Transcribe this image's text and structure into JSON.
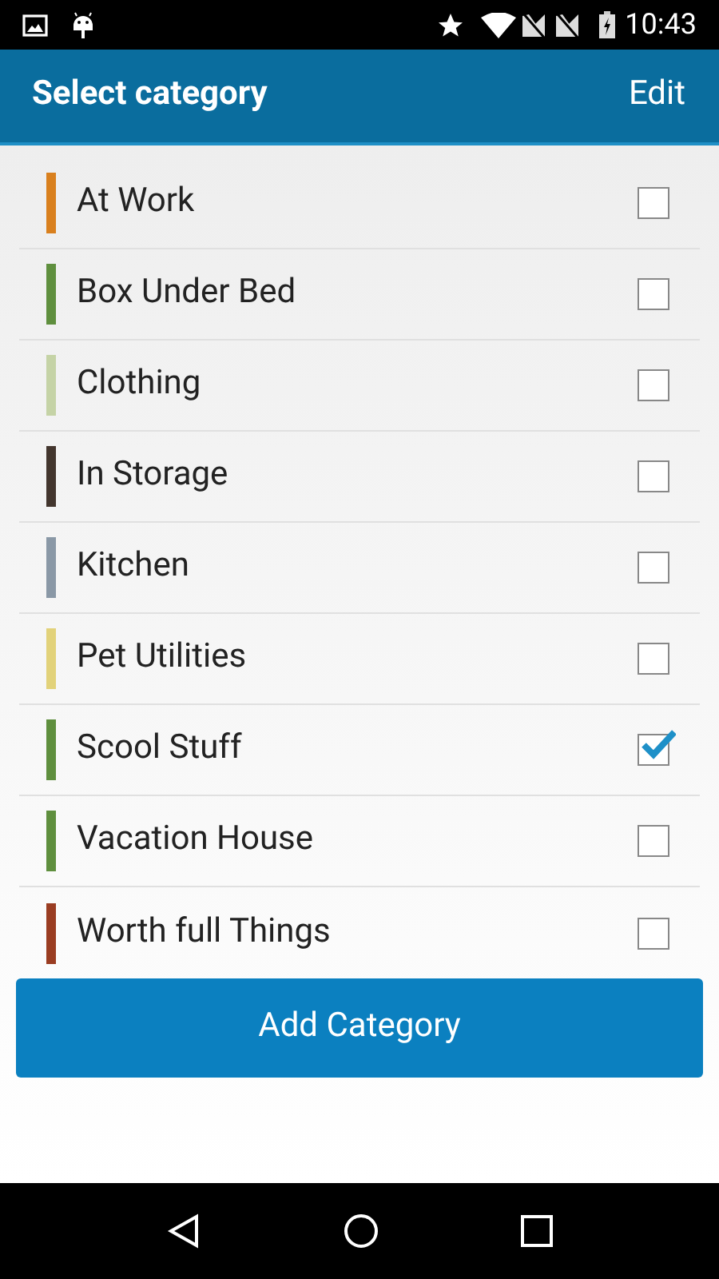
{
  "status_bar": {
    "time": "10:43"
  },
  "app_bar": {
    "title": "Select category",
    "action": "Edit"
  },
  "categories": [
    {
      "label": "At Work",
      "color": "#d9801e",
      "checked": false
    },
    {
      "label": "Box Under Bed",
      "color": "#5f8f3e",
      "checked": false
    },
    {
      "label": "Clothing",
      "color": "#c5d3a6",
      "checked": false
    },
    {
      "label": "In Storage",
      "color": "#43362e",
      "checked": false
    },
    {
      "label": "Kitchen",
      "color": "#8a98a6",
      "checked": false
    },
    {
      "label": "Pet Utilities",
      "color": "#e2d27a",
      "checked": false
    },
    {
      "label": "Scool Stuff",
      "color": "#5f8f3e",
      "checked": true
    },
    {
      "label": "Vacation House",
      "color": "#5f8f3e",
      "checked": false
    },
    {
      "label": "Worth full Things",
      "color": "#9a3d22",
      "checked": false
    }
  ],
  "add_button": "Add Category"
}
